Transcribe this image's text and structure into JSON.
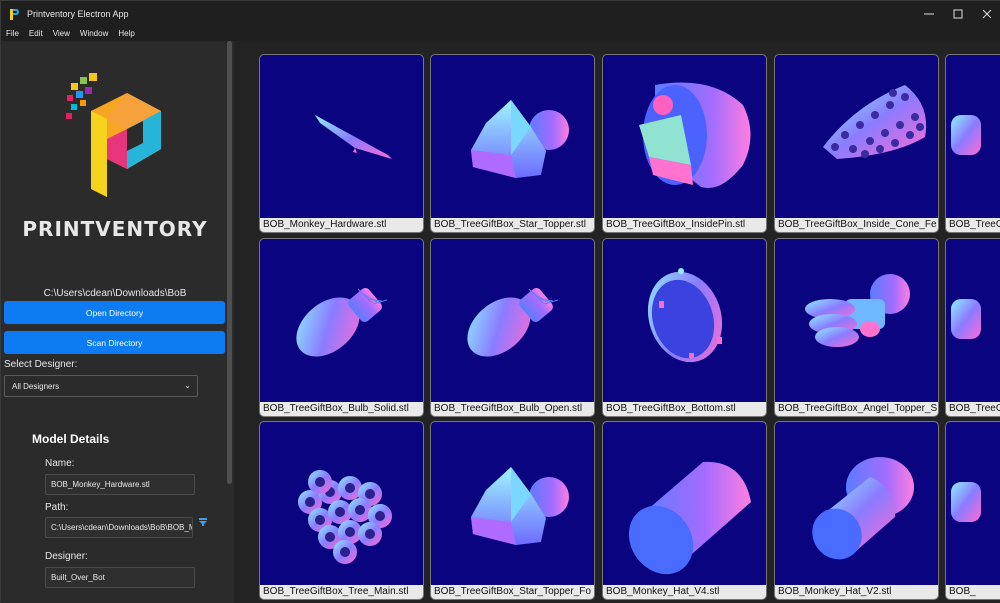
{
  "window": {
    "title": "Printventory Electron App",
    "controls": [
      "minimize",
      "maximize",
      "close"
    ]
  },
  "menu": [
    "File",
    "Edit",
    "View",
    "Window",
    "Help"
  ],
  "sidebar": {
    "brand": "PRINTVENTORY",
    "directory_path": "C:\\Users\\cdean\\Downloads\\BoB",
    "open_button": "Open Directory",
    "scan_button": "Scan Directory",
    "select_label": "Select Designer:",
    "designer_selected": "All Designers",
    "details_title": "Model Details",
    "name_label": "Name:",
    "name_value": "BOB_Monkey_Hardware.stl",
    "path_label": "Path:",
    "path_value": "C:\\Users\\cdean\\Downloads\\BoB\\BOB_Monkey_Hardware.stl",
    "designer_label": "Designer:",
    "designer_value": "Built_Over_Bot"
  },
  "models": [
    {
      "file": "BOB_Monkey_Hardware.stl",
      "shape": "blade"
    },
    {
      "file": "BOB_TreeGiftBox_Star_Topper.stl",
      "shape": "star"
    },
    {
      "file": "BOB_TreeGiftBox_InsidePin.stl",
      "shape": "pin"
    },
    {
      "file": "BOB_TreeGiftBox_Inside_Cone_Fe",
      "shape": "cone"
    },
    {
      "file": "BOB_TreeGi",
      "shape": "partial"
    },
    {
      "file": "BOB_TreeGiftBox_Bulb_Solid.stl",
      "shape": "bulb"
    },
    {
      "file": "BOB_TreeGiftBox_Bulb_Open.stl",
      "shape": "bulb"
    },
    {
      "file": "BOB_TreeGiftBox_Bottom.stl",
      "shape": "disc"
    },
    {
      "file": "BOB_TreeGiftBox_Angel_Topper_S",
      "shape": "angel"
    },
    {
      "file": "BOB_TreeG",
      "shape": "partial"
    },
    {
      "file": "BOB_TreeGiftBox_Tree_Main.stl",
      "shape": "tree"
    },
    {
      "file": "BOB_TreeGiftBox_Star_Topper_Fo",
      "shape": "star"
    },
    {
      "file": "BOB_Monkey_Hat_V4.stl",
      "shape": "cylinder"
    },
    {
      "file": "BOB_Monkey_Hat_V2.stl",
      "shape": "hat"
    },
    {
      "file": "BOB_",
      "shape": "partial"
    }
  ]
}
